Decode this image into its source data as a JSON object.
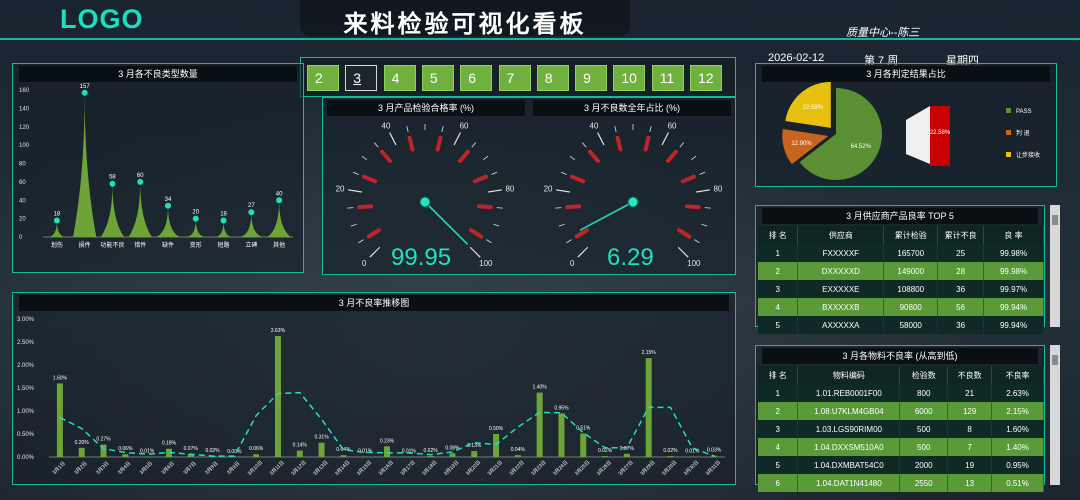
{
  "header": {
    "logo": "LOGO",
    "title": "来料检验可视化看板",
    "dept": "质量中心--陈三"
  },
  "datebar": {
    "date": "2026-02-12",
    "week": "第 7 周",
    "weekday": "星期四"
  },
  "months": {
    "options": [
      "2",
      "3",
      "4",
      "5",
      "6",
      "7",
      "8",
      "9",
      "10",
      "11",
      "12"
    ],
    "selected": "3"
  },
  "defect_type": {
    "title": "3 月各不良类型数量",
    "chart_data": {
      "type": "area",
      "categories": [
        "划伤",
        "损件",
        "功能不良",
        "错件",
        "缺件",
        "变形",
        "短路",
        "立碑",
        "其他"
      ],
      "values": [
        18,
        157,
        58,
        60,
        34,
        20,
        18,
        27,
        40
      ],
      "ylim": [
        0,
        160
      ],
      "yticks": [
        "0",
        "20",
        "40",
        "60",
        "80",
        "100",
        "120",
        "140",
        "160"
      ]
    }
  },
  "gauges": {
    "pass_title": "3 月产品检验合格率 (%)",
    "defect_title": "3 月不良数全年占比 (%)",
    "pass_value": "99.95",
    "defect_value": "6.29",
    "pass_level": 99.95,
    "defect_level": 6.29,
    "ticks": [
      "0",
      "20",
      "40",
      "60",
      "80",
      "100"
    ]
  },
  "verdict": {
    "title": "3 月各判定结果占比",
    "chart_data": {
      "type": "pie",
      "series": [
        {
          "name": "PASS",
          "value": 64.52,
          "label": "64.52%",
          "color": "#5a8f34"
        },
        {
          "name": "判退",
          "value": 12.9,
          "label": "12.90%",
          "color": "#c8641e"
        },
        {
          "name": "让步接收",
          "value": 22.58,
          "label": "22.58%",
          "color": "#e8c010"
        }
      ]
    },
    "bar_label": "22.58%",
    "legend": [
      "PASS",
      "判 退",
      "让步接收"
    ]
  },
  "supplier": {
    "title": "3 月供应商产品良率 TOP 5",
    "headers": [
      "排 名",
      "供应商",
      "累计检验",
      "累计不良",
      "良 率"
    ],
    "rows": [
      [
        "1",
        "FXXXXXF",
        "165700",
        "25",
        "99.98%"
      ],
      [
        "2",
        "DXXXXXD",
        "149000",
        "28",
        "99.98%"
      ],
      [
        "3",
        "EXXXXXE",
        "108800",
        "36",
        "99.97%"
      ],
      [
        "4",
        "BXXXXXB",
        "90800",
        "56",
        "99.94%"
      ],
      [
        "5",
        "AXXXXXA",
        "58000",
        "36",
        "99.94%"
      ]
    ]
  },
  "material": {
    "title": "3 月各物料不良率 (从高到低)",
    "headers": [
      "排 名",
      "物料编码",
      "检验数",
      "不良数",
      "不良率"
    ],
    "rows": [
      [
        "1",
        "1.01.REB0001F00",
        "800",
        "21",
        "2.63%"
      ],
      [
        "2",
        "1.08.U7KLM4GB04",
        "6000",
        "129",
        "2.15%"
      ],
      [
        "3",
        "1.03.LGS90RIM00",
        "500",
        "8",
        "1.60%"
      ],
      [
        "4",
        "1.04.DXXSM510A0",
        "500",
        "7",
        "1.40%"
      ],
      [
        "5",
        "1.04.DXMBAT54C0",
        "2000",
        "19",
        "0.95%"
      ],
      [
        "6",
        "1.04.DAT1N41480",
        "2550",
        "13",
        "0.51%"
      ]
    ]
  },
  "trend": {
    "title": "3 月不良率推移图",
    "yticks": [
      "0.00%",
      "0.50%",
      "1.00%",
      "1.50%",
      "2.00%",
      "2.50%",
      "3.00%"
    ],
    "chart_data": {
      "type": "bar",
      "ylim": [
        0,
        3
      ],
      "categories": [
        "3月1日",
        "3月2日",
        "3月3日",
        "3月4日",
        "3月5日",
        "3月6日",
        "3月7日",
        "3月8日",
        "3月9日",
        "3月10日",
        "3月11日",
        "3月12日",
        "3月13日",
        "3月14日",
        "3月15日",
        "3月16日",
        "3月17日",
        "3月18日",
        "3月19日",
        "3月20日",
        "3月21日",
        "3月22日",
        "3月23日",
        "3月24日",
        "3月25日",
        "3月26日",
        "3月27日",
        "3月28日",
        "3月29日",
        "3月30日",
        "3月31日"
      ],
      "values": [
        1.6,
        0.2,
        0.27,
        0.06,
        0.01,
        0.18,
        0.07,
        0.02,
        0.0,
        0.06,
        2.63,
        0.14,
        0.31,
        0.04,
        0.01,
        0.23,
        0.01,
        0.02,
        0.08,
        0.13,
        0.5,
        0.04,
        1.4,
        0.95,
        0.51,
        0.02,
        0.07,
        2.15,
        0.02,
        0.01,
        0.03
      ],
      "labels": [
        "1.60%",
        "0.20%",
        "0.27%",
        "0.06%",
        "0.01%",
        "0.18%",
        "0.07%",
        "0.02%",
        "0.00%",
        "0.06%",
        "2.63%",
        "0.14%",
        "0.31%",
        "0.04%",
        "0.01%",
        "0.23%",
        "0.01%",
        "0.02%",
        "0.08%",
        "0.13%",
        "0.50%",
        "0.04%",
        "1.40%",
        "0.95%",
        "0.51%",
        "0.02%",
        "0.07%",
        "2.15%",
        "0.02%",
        "0.01%",
        "0.03%"
      ],
      "trendline": [
        0.86,
        0.62,
        0.18,
        0.1,
        0.06,
        0.1,
        0.06,
        0.02,
        0.02,
        0.9,
        1.38,
        1.4,
        0.82,
        0.16,
        0.1,
        0.09,
        0.09,
        0.05,
        0.11,
        0.31,
        0.27,
        0.65,
        0.97,
        0.96,
        0.53,
        0.2,
        0.2,
        1.08,
        1.08,
        0.2,
        0.02
      ]
    }
  }
}
